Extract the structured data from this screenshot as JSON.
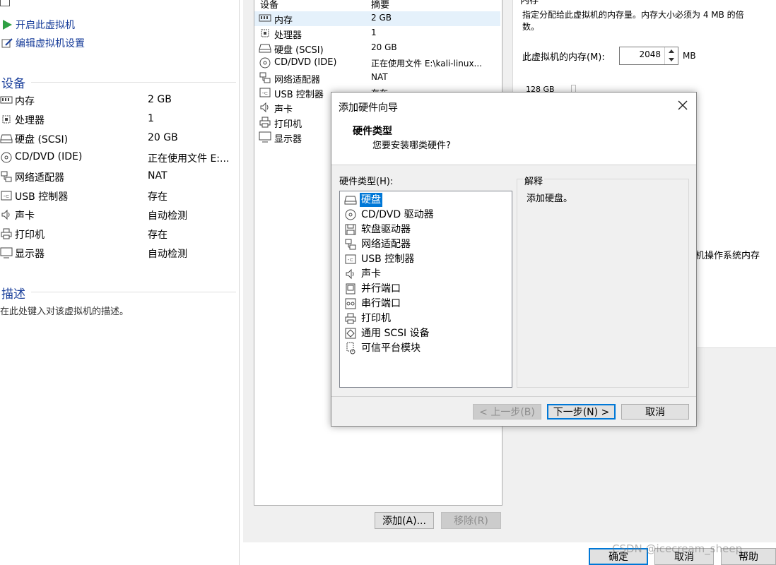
{
  "left": {
    "actions": [
      {
        "label": "开启此虚拟机",
        "icon": "play-icon"
      },
      {
        "label": "编辑虚拟机设置",
        "icon": "edit-settings-icon"
      }
    ],
    "devices_title": "设备",
    "devices": [
      {
        "name": "内存",
        "value": "2 GB",
        "icon": "memory-icon"
      },
      {
        "name": "处理器",
        "value": "1",
        "icon": "processor-icon"
      },
      {
        "name": "硬盘 (SCSI)",
        "value": "20 GB",
        "icon": "hard-disk-icon"
      },
      {
        "name": "CD/DVD (IDE)",
        "value": "正在使用文件 E:...",
        "icon": "cd-dvd-icon"
      },
      {
        "name": "网络适配器",
        "value": "NAT",
        "icon": "network-adapter-icon"
      },
      {
        "name": "USB 控制器",
        "value": "存在",
        "icon": "usb-icon"
      },
      {
        "name": "声卡",
        "value": "自动检测",
        "icon": "sound-icon"
      },
      {
        "name": "打印机",
        "value": "存在",
        "icon": "printer-icon"
      },
      {
        "name": "显示器",
        "value": "自动检测",
        "icon": "display-icon"
      }
    ],
    "description_title": "描述",
    "description_text": "在此处键入对该虚拟机的描述。"
  },
  "settings": {
    "col_device": "设备",
    "col_summary": "摘要",
    "devices": [
      {
        "name": "内存",
        "value": "2 GB",
        "icon": "memory-icon"
      },
      {
        "name": "处理器",
        "value": "1",
        "icon": "processor-icon"
      },
      {
        "name": "硬盘 (SCSI)",
        "value": "20 GB",
        "icon": "hard-disk-icon"
      },
      {
        "name": "CD/DVD (IDE)",
        "value": "正在使用文件 E:\\kali-linux...",
        "icon": "cd-dvd-icon"
      },
      {
        "name": "网络适配器",
        "value": "NAT",
        "icon": "network-adapter-icon"
      },
      {
        "name": "USB 控制器",
        "value": "存在",
        "icon": "usb-icon"
      },
      {
        "name": "声卡",
        "value": "",
        "icon": "sound-icon"
      },
      {
        "name": "打印机",
        "value": "",
        "icon": "printer-icon"
      },
      {
        "name": "显示器",
        "value": "",
        "icon": "display-icon"
      }
    ],
    "add_button": "添加(A)...",
    "remove_button": "移除(R)",
    "memory_title": "内存",
    "memory_desc": "指定分配给此虚拟机的内存量。内存大小必须为 4 MB 的倍数。",
    "memory_label": "此虚拟机的内存(M):",
    "memory_value": "2048",
    "memory_unit": "MB",
    "memory_scale_top": "128 GB",
    "memory_hint": "机操作系统内存",
    "ok_button": "确定",
    "cancel_button": "取消",
    "help_button": "帮助",
    "watermark": "CSDN @icecream_sheep"
  },
  "dialog": {
    "title": "添加硬件向导",
    "heading": "硬件类型",
    "subheading": "您要安装哪类硬件?",
    "list_label": "硬件类型(H):",
    "items": [
      {
        "label": "硬盘",
        "icon": "hard-disk-icon"
      },
      {
        "label": "CD/DVD 驱动器",
        "icon": "cd-dvd-icon"
      },
      {
        "label": "软盘驱动器",
        "icon": "floppy-icon"
      },
      {
        "label": "网络适配器",
        "icon": "network-adapter-icon"
      },
      {
        "label": "USB 控制器",
        "icon": "usb-icon"
      },
      {
        "label": "声卡",
        "icon": "sound-icon"
      },
      {
        "label": "并行端口",
        "icon": "parallel-port-icon"
      },
      {
        "label": "串行端口",
        "icon": "serial-port-icon"
      },
      {
        "label": "打印机",
        "icon": "printer-icon"
      },
      {
        "label": "通用 SCSI 设备",
        "icon": "scsi-device-icon"
      },
      {
        "label": "可信平台模块",
        "icon": "tpm-icon"
      }
    ],
    "selected_index": 0,
    "explain_title": "解释",
    "explain_text": "添加硬盘。",
    "back_button": "< 上一步(B)",
    "next_button": "下一步(N) >",
    "cancel_button": "取消"
  }
}
